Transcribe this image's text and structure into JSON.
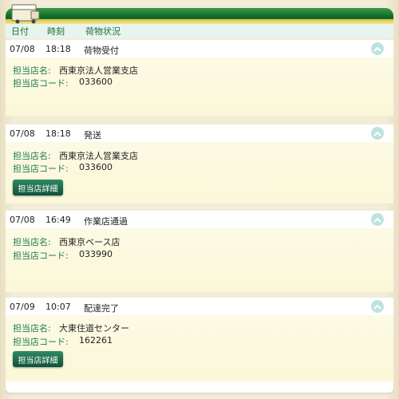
{
  "header": {
    "date_label": "日付",
    "time_label": "時刻",
    "status_label": "荷物状況"
  },
  "labels": {
    "store_name": "担当店名:",
    "store_code": "担当店コード:"
  },
  "events": [
    {
      "date": "07/08",
      "time": "18:18",
      "status": "荷物受付",
      "store_name": "西東京法人営業支店",
      "store_code": "033600",
      "button": ""
    },
    {
      "date": "07/08",
      "time": "18:18",
      "status": "発送",
      "store_name": "西東京法人営業支店",
      "store_code": "033600",
      "button": "担当店詳細"
    },
    {
      "date": "07/08",
      "time": "16:49",
      "status": "作業店通過",
      "store_name": "西東京ベース店",
      "store_code": "033990",
      "button": ""
    },
    {
      "date": "07/09",
      "time": "10:07",
      "status": "配達完了",
      "store_name": "大東住道センター",
      "store_code": "162261",
      "button": "担当店詳細"
    }
  ],
  "icons": {
    "chevron": "chevron-up-icon",
    "truck": "truck-icon"
  },
  "colors": {
    "brand_green": "#0f6a28",
    "label_green": "#1b7a4e",
    "gold": "#e6d36a",
    "chevron_bg": "#bde3df"
  }
}
